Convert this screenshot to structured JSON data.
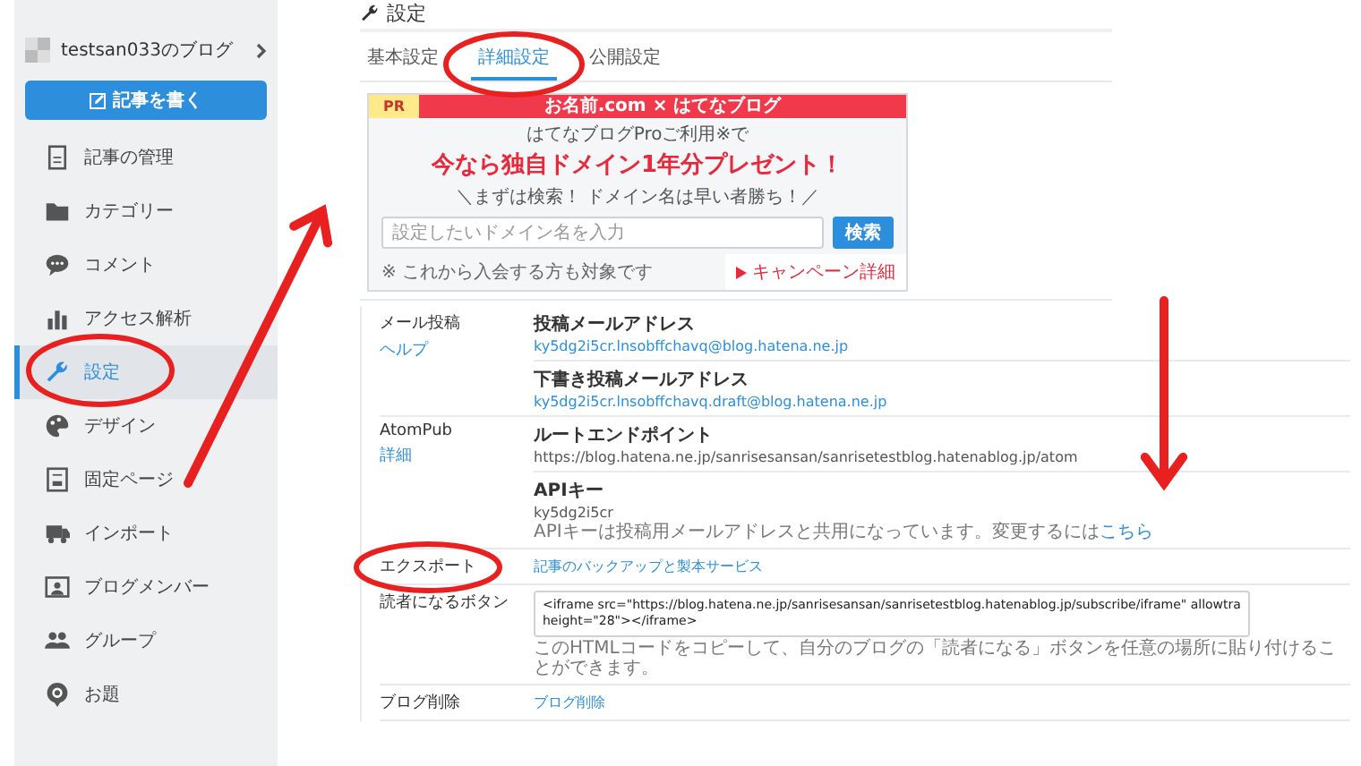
{
  "sidebar": {
    "blog_name": "testsan033のブログ",
    "write_button": "記事を書く",
    "items": [
      {
        "label": "記事の管理",
        "selected": false
      },
      {
        "label": "カテゴリー",
        "selected": false
      },
      {
        "label": "コメント",
        "selected": false
      },
      {
        "label": "アクセス解析",
        "selected": false
      },
      {
        "label": "設定",
        "selected": true
      },
      {
        "label": "デザイン",
        "selected": false
      },
      {
        "label": "固定ページ",
        "selected": false
      },
      {
        "label": "インポート",
        "selected": false
      },
      {
        "label": "ブログメンバー",
        "selected": false
      },
      {
        "label": "グループ",
        "selected": false
      },
      {
        "label": "お題",
        "selected": false
      }
    ]
  },
  "page_title": "設定",
  "tabs": [
    {
      "label": "基本設定",
      "selected": false
    },
    {
      "label": "詳細設定",
      "selected": true
    },
    {
      "label": "公開設定",
      "selected": false
    }
  ],
  "ad": {
    "badge": "PR",
    "header": "お名前.com × はてなブログ",
    "lead": "はてなブログProご利用※で",
    "headline": "今なら独自ドメイン1年分プレゼント！",
    "subline": "＼まずは検索！ ドメイン名は早い者勝ち！／",
    "search": {
      "placeholder": "設定したいドメイン名を入力"
    },
    "search_button": "検索",
    "note": "※ これから入会する方も対象です",
    "campaign_link": "キャンペーン詳細"
  },
  "settings": [
    {
      "label": "メール投稿",
      "link": "ヘルプ",
      "entries": [
        {
          "kind": "link",
          "title": "投稿メールアドレス",
          "value": "ky5dg2i5cr.lnsobffchavq@blog.hatena.ne.jp"
        },
        {
          "kind": "link",
          "title": "下書き投稿メールアドレス",
          "value": "ky5dg2i5cr.lnsobffchavq.draft@blog.hatena.ne.jp"
        }
      ]
    },
    {
      "label": "AtomPub",
      "link": "詳細",
      "entries": [
        {
          "kind": "text",
          "title": "ルートエンドポイント",
          "value": "https://blog.hatena.ne.jp/sanrisesansan/sanrisetestblog.hatenablog.jp/atom"
        },
        {
          "kind": "text",
          "title": "APIキー",
          "value": "ky5dg2i5cr",
          "note": "APIキーは投稿用メールアドレスと共用になっています。変更するには",
          "note_link": "こちら"
        }
      ]
    },
    {
      "label": "エクスポート",
      "entries": [
        {
          "kind": "link",
          "value": "記事のバックアップと製本サービス"
        }
      ]
    },
    {
      "label": "読者になるボタン",
      "entries": [
        {
          "kind": "code",
          "value": "<iframe src=\"https://blog.hatena.ne.jp/sanrisesansan/sanrisetestblog.hatenablog.jp/subscribe/iframe\" allowtra\nheight=\"28\"></iframe>",
          "note": "このHTMLコードをコピーして、自分のブログの「読者になる」ボタンを任意の場所に貼り付けることができます。"
        }
      ]
    },
    {
      "label": "ブログ削除",
      "entries": [
        {
          "kind": "link",
          "value": "ブログ削除"
        }
      ]
    }
  ],
  "annotations": [
    {
      "kind": "circle"
    },
    {
      "kind": "circle"
    },
    {
      "kind": "circle"
    },
    {
      "kind": "arrow"
    },
    {
      "kind": "arrow"
    }
  ]
}
